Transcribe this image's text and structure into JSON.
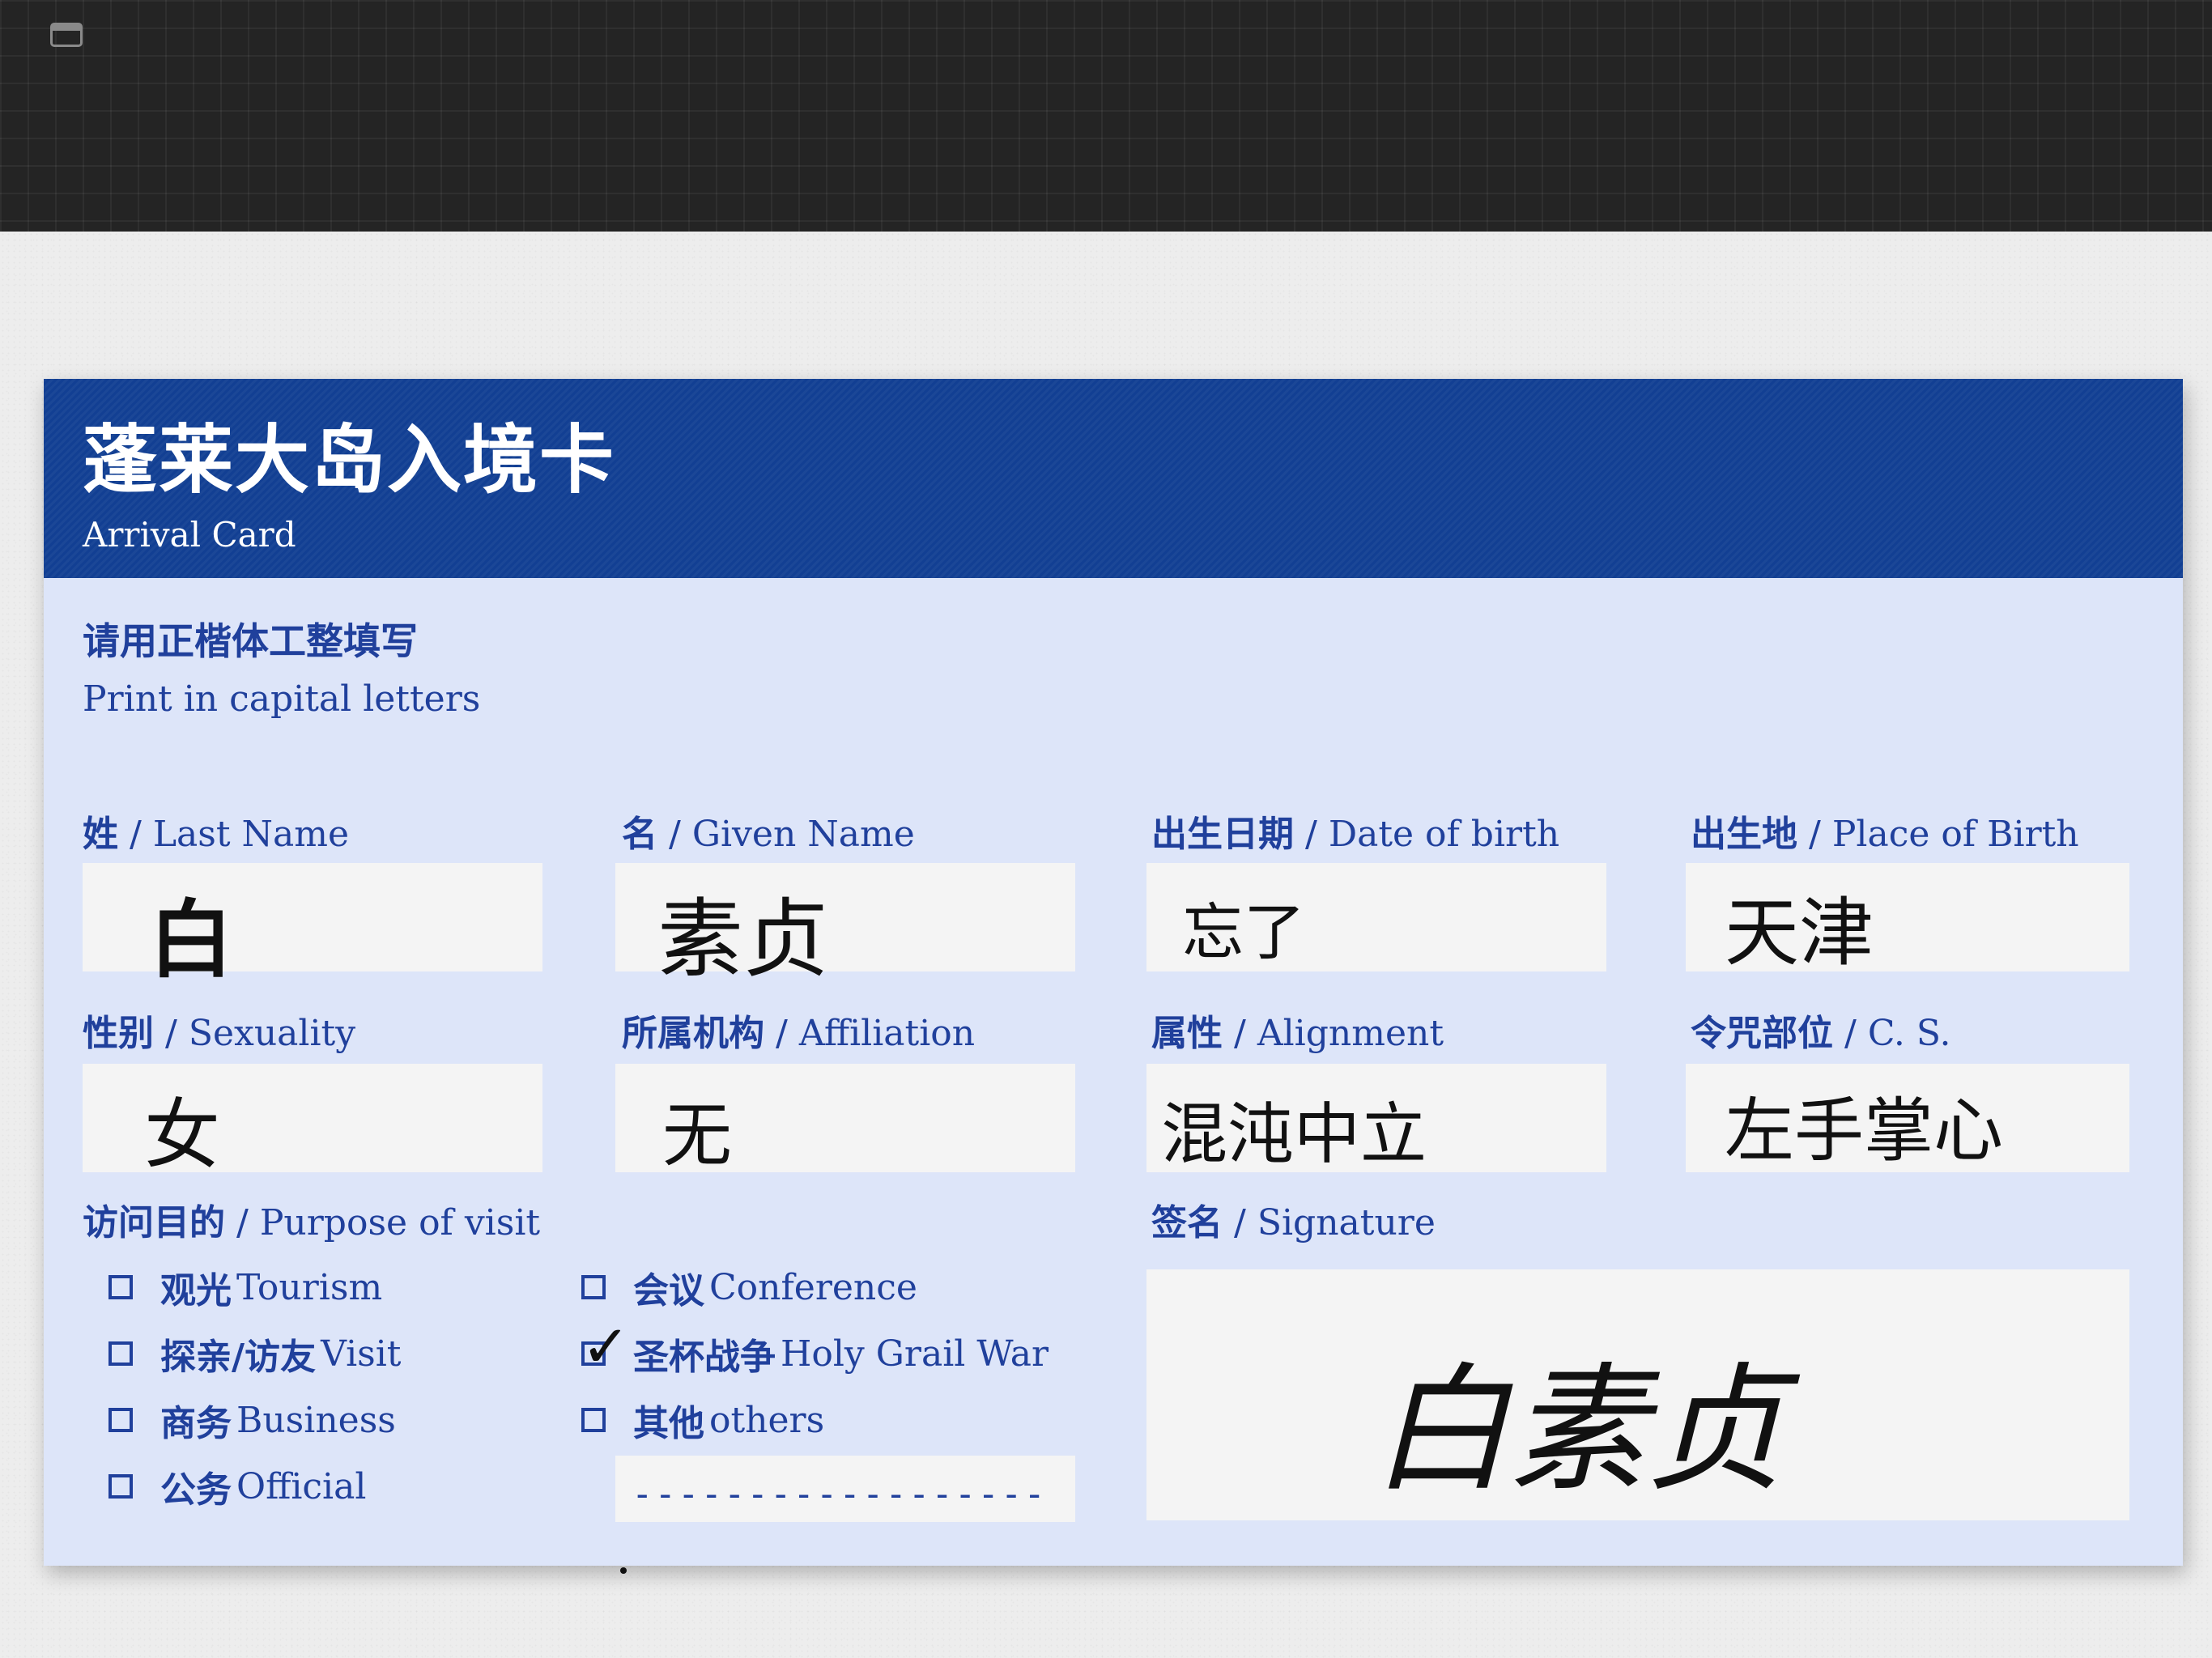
{
  "card": {
    "title": "蓬莱大岛入境卡",
    "subtitle": "Arrival Card",
    "instruction_cn": "请用正楷体工整填写",
    "instruction_en": "Print in capital letters"
  },
  "fields": {
    "last_name": {
      "label_cn": "姓",
      "label_en": "Last Name",
      "value": "白"
    },
    "given_name": {
      "label_cn": "名",
      "label_en": "Given Name",
      "value": "素贞"
    },
    "dob": {
      "label_cn": "出生日期",
      "label_en": "Date of birth",
      "value": "忘了"
    },
    "pob": {
      "label_cn": "出生地",
      "label_en": "Place of Birth",
      "value": "天津"
    },
    "sexuality": {
      "label_cn": "性别",
      "label_en": "Sexuality",
      "value": "女"
    },
    "affiliation": {
      "label_cn": "所属机构",
      "label_en": "Affiliation",
      "value": "无"
    },
    "alignment": {
      "label_cn": "属性",
      "label_en": "Alignment",
      "value": "混沌中立"
    },
    "cs": {
      "label_cn": "令咒部位",
      "label_en": "C. S.",
      "value": "左手掌心"
    }
  },
  "purpose": {
    "label_cn": "访问目的",
    "label_en": "Purpose of visit",
    "options": [
      {
        "cn": "观光",
        "en": "Tourism",
        "checked": false
      },
      {
        "cn": "探亲/访友",
        "en": "Visit",
        "checked": false
      },
      {
        "cn": "商务",
        "en": "Business",
        "checked": false
      },
      {
        "cn": "公务",
        "en": "Official",
        "checked": false
      },
      {
        "cn": "会议",
        "en": "Conference",
        "checked": false
      },
      {
        "cn": "圣杯战争",
        "en": "Holy Grail War",
        "checked": true
      },
      {
        "cn": "其他",
        "en": "others",
        "checked": false
      }
    ],
    "other_line": "------------------"
  },
  "signature": {
    "label_cn": "签名",
    "label_en": "Signature",
    "value": "白素贞"
  },
  "sep": "/"
}
